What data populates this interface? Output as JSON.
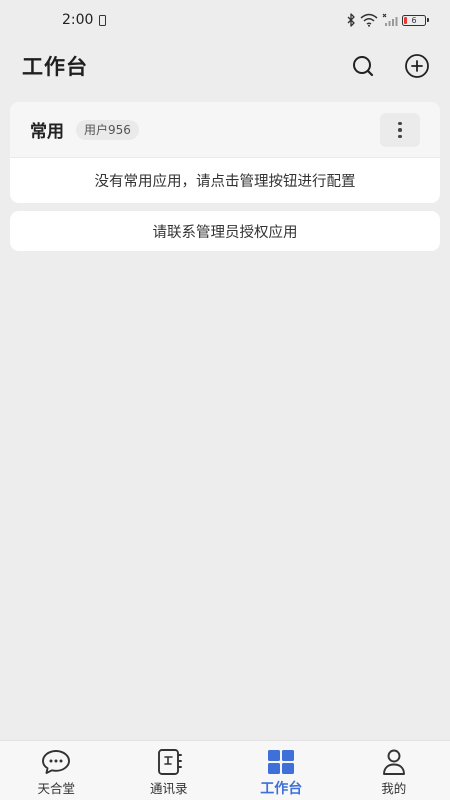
{
  "status_bar": {
    "time": "2:00",
    "battery_level": "6"
  },
  "header": {
    "title": "工作台"
  },
  "common_card": {
    "title": "常用",
    "user_badge": "用户956",
    "empty_text": "没有常用应用，请点击管理按钮进行配置"
  },
  "auth_card": {
    "text": "请联系管理员授权应用"
  },
  "tab_bar": {
    "tabs": [
      {
        "label": "天合堂",
        "icon": "chat-bubble-icon",
        "active": false
      },
      {
        "label": "通讯录",
        "icon": "contacts-book-icon",
        "active": false
      },
      {
        "label": "工作台",
        "icon": "grid-icon",
        "active": true
      },
      {
        "label": "我的",
        "icon": "person-icon",
        "active": false
      }
    ]
  },
  "colors": {
    "accent": "#3F6FD8",
    "background": "#EDEDED",
    "battery_low": "#E53935"
  }
}
